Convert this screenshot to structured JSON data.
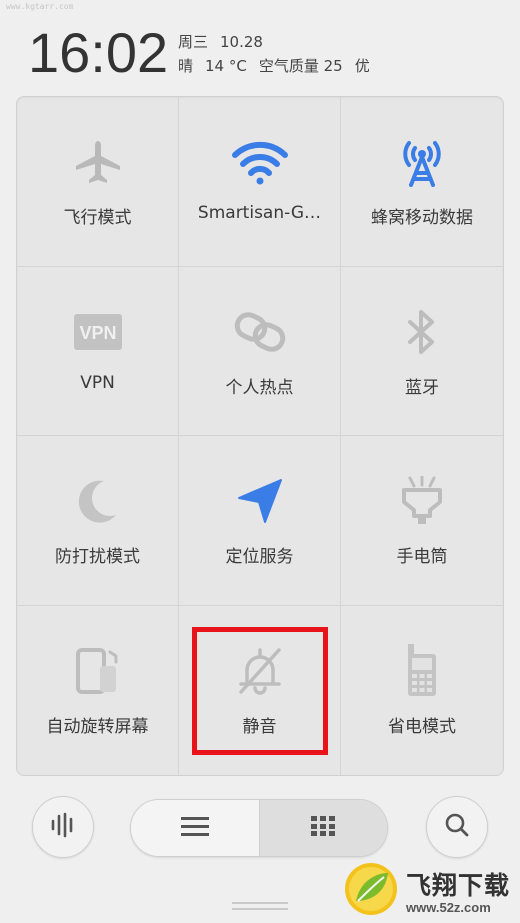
{
  "watermark_top": "www.kgtarr.com",
  "status": {
    "time": "16:02",
    "weekday": "周三",
    "date": "10.28",
    "weather": "晴",
    "temperature": "14 °C",
    "air_quality": "空气质量 25",
    "air_quality_level": "优"
  },
  "tiles": [
    {
      "label": "飞行模式",
      "icon": "airplane-icon",
      "active": false
    },
    {
      "label": "Smartisan-G…",
      "icon": "wifi-icon",
      "active": true
    },
    {
      "label": "蜂窝移动数据",
      "icon": "cellular-tower-icon",
      "active": true
    },
    {
      "label": "VPN",
      "icon": "vpn-icon",
      "active": false
    },
    {
      "label": "个人热点",
      "icon": "hotspot-link-icon",
      "active": false
    },
    {
      "label": "蓝牙",
      "icon": "bluetooth-icon",
      "active": false
    },
    {
      "label": "防打扰模式",
      "icon": "moon-icon",
      "active": false
    },
    {
      "label": "定位服务",
      "icon": "location-arrow-icon",
      "active": true
    },
    {
      "label": "手电筒",
      "icon": "flashlight-icon",
      "active": false
    },
    {
      "label": "自动旋转屏幕",
      "icon": "rotate-screen-icon",
      "active": false
    },
    {
      "label": "静音",
      "icon": "bell-muted-icon",
      "active": false
    },
    {
      "label": "省电模式",
      "icon": "battery-phone-icon",
      "active": false
    }
  ],
  "colors": {
    "active_blue": "#3b7de6",
    "inactive_gray": "#b9b9b9",
    "highlight_red": "#e8141a"
  },
  "logo": {
    "title": "飞翔下载",
    "url": "www.52z.com"
  }
}
